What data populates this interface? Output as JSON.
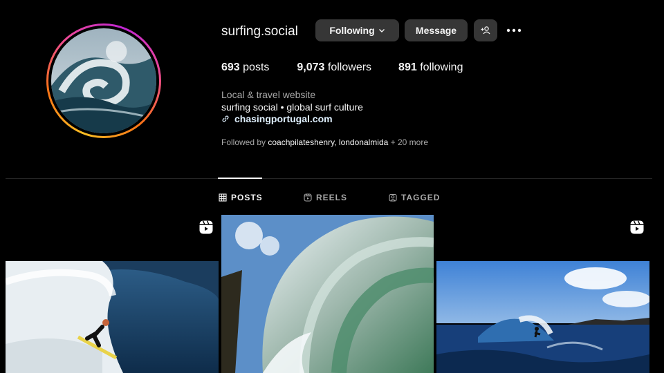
{
  "profile": {
    "username": "surfing.social",
    "avatar_icon": "wave-photo",
    "ring_colors": [
      "#fbbf24",
      "#f97316",
      "#ec4899",
      "#c026d3"
    ]
  },
  "actions": {
    "following_label": "Following",
    "message_label": "Message",
    "add_user_icon": "add-user-icon",
    "more_icon": "more-dots-icon"
  },
  "stats": {
    "posts_count": "693",
    "posts_label": "posts",
    "followers_count": "9,073",
    "followers_label": "followers",
    "following_count": "891",
    "following_label": "following"
  },
  "bio": {
    "category": "Local & travel website",
    "text": "surfing social • global surf culture",
    "link": "chasingportugal.com"
  },
  "followed_by": {
    "prefix": "Followed by",
    "name1": "coachpilateshenry",
    "separator": ",",
    "name2": "londonalmida",
    "more": "+ 20 more"
  },
  "tabs": [
    {
      "label": "POSTS",
      "icon": "grid-icon",
      "active": true
    },
    {
      "label": "REELS",
      "icon": "reels-icon",
      "active": false
    },
    {
      "label": "TAGGED",
      "icon": "tagged-icon",
      "active": false
    }
  ],
  "posts": [
    {
      "subject": "surfer-in-barrel",
      "is_reel": true
    },
    {
      "subject": "wave-curl-closeup",
      "is_reel": false
    },
    {
      "subject": "surfer-on-wave-coast",
      "is_reel": true
    }
  ]
}
